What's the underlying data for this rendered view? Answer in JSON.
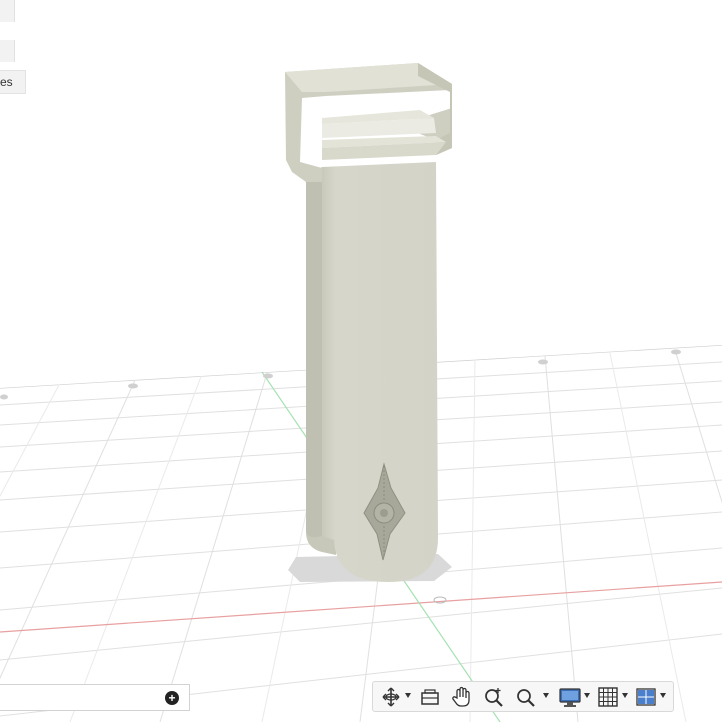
{
  "browser_panel": {
    "label": "es"
  },
  "comments_bar": {
    "add_symbol": "+"
  },
  "navigation_toolbar": {
    "tools": [
      "orbit",
      "look-at",
      "pan",
      "zoom",
      "fit",
      "display-settings",
      "grid-and-snaps",
      "viewports"
    ]
  },
  "colors": {
    "model": "#cdcdc0",
    "grid_line": "#dddddd",
    "x_axis": "#e8a0a0",
    "y_axis": "#a5e2b1",
    "toolbar_bg": "#f7f7f7"
  }
}
